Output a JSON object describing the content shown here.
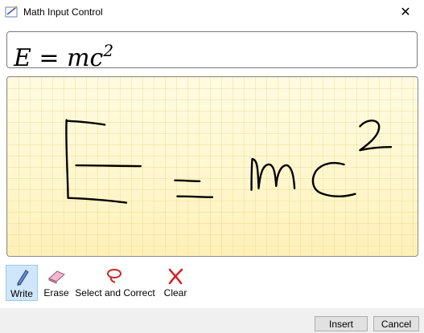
{
  "window": {
    "title": "Math Input Control",
    "close_glyph": "✕",
    "app_icon": "math-input-icon"
  },
  "preview": {
    "formula_base": "E = mc",
    "formula_sup": "2"
  },
  "toolbar": {
    "write_label": "Write",
    "erase_label": "Erase",
    "select_label": "Select and Correct",
    "clear_label": "Clear"
  },
  "footer": {
    "insert_label": "Insert",
    "cancel_label": "Cancel"
  },
  "colors": {
    "pad_bg": "#fff7cf",
    "active_tool": "#cfe6fb",
    "clear_red": "#d42020",
    "select_red": "#c62a2a"
  }
}
